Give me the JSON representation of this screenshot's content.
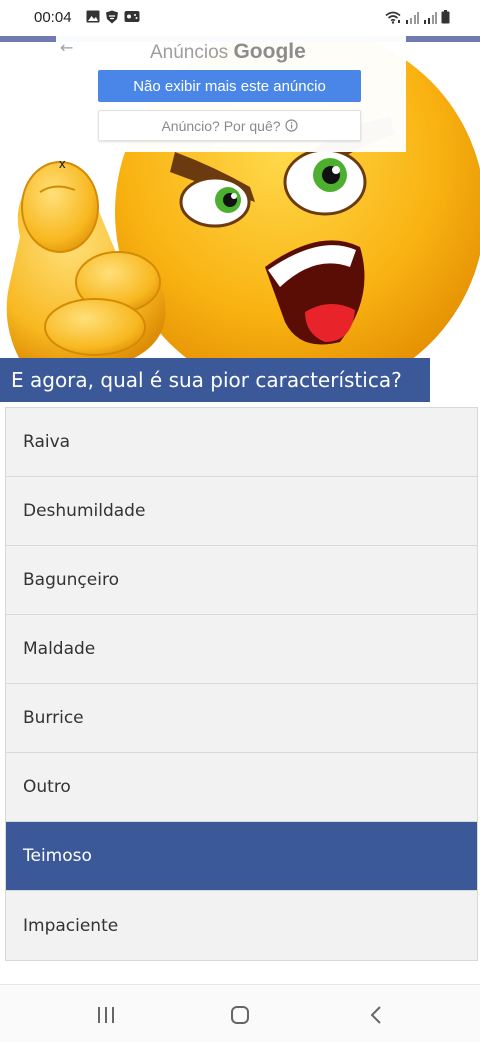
{
  "status_bar": {
    "time": "00:04",
    "left_icons": [
      "image-icon",
      "shield-icon",
      "game-icon"
    ],
    "right_icons": [
      "wifi-icon",
      "signal-icon",
      "signal-icon",
      "battery-icon"
    ]
  },
  "ad": {
    "label": "Anúncios",
    "brand": "Google",
    "hide_button": "Não exibir mais este anúncio",
    "why_button": "Anúncio? Por quê?",
    "close": "x",
    "back_icon": "back-arrow-icon",
    "info_icon": "info-icon"
  },
  "hero": {
    "image": "angry-emoji-pointing-finger"
  },
  "quiz": {
    "question": "E agora, qual é sua pior característica?",
    "options": [
      "Raiva",
      "Deshumildade",
      "Bagunçeiro",
      "Maldade",
      "Burrice",
      "Outro",
      "Teimoso",
      "Impaciente"
    ],
    "selected": "Teimoso"
  },
  "nav_bar": {
    "buttons": [
      "recent-apps-icon",
      "home-icon",
      "back-icon"
    ]
  },
  "colors": {
    "accent": "#3b5998",
    "ad_button": "#4a86e8",
    "emoji_face": "#f9b312"
  }
}
